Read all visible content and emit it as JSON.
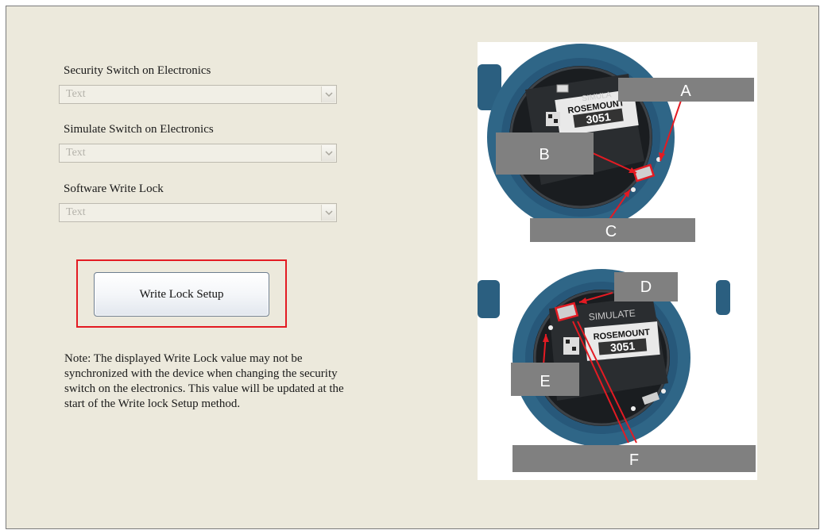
{
  "fields": [
    {
      "label": "Security Switch on Electronics",
      "value": "Text"
    },
    {
      "label": "Simulate Switch on Electronics",
      "value": "Text"
    },
    {
      "label": "Software Write Lock",
      "value": "Text"
    }
  ],
  "button": {
    "label": "Write Lock Setup"
  },
  "note": "Note: The displayed Write Lock value may not be synchronized with the device when changing the security switch on the electronics. This value will be updated at the start of the Write lock Setup method.",
  "images": {
    "top": {
      "callouts": [
        "A",
        "B",
        "C"
      ],
      "housing_text": "SIMULA",
      "brand": "ROSEMOUNT",
      "model": "3051"
    },
    "bottom": {
      "callouts": [
        "D",
        "E",
        "F"
      ],
      "housing_text": "SIMULATE",
      "brand": "ROSEMOUNT",
      "model": "3051"
    }
  },
  "colors": {
    "panel": "#ece9dc",
    "highlight": "#e31b23",
    "callout": "#808080",
    "housing": "#2f6687"
  },
  "icons": [
    "dropdown-arrow-icon"
  ]
}
